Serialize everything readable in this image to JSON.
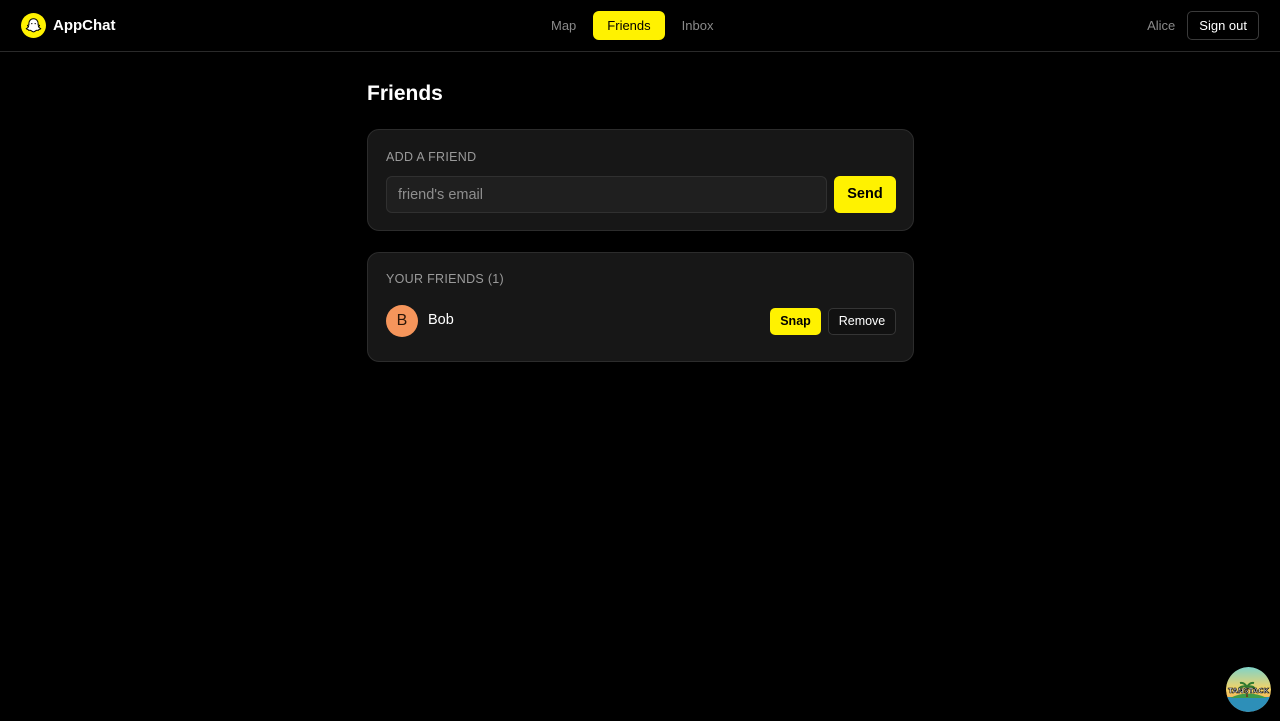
{
  "header": {
    "brand_name": "AppChat",
    "logo_icon": "ghost-icon",
    "nav": [
      {
        "label": "Map",
        "active": false
      },
      {
        "label": "Friends",
        "active": true
      },
      {
        "label": "Inbox",
        "active": false
      }
    ],
    "user_name": "Alice",
    "signout_label": "Sign out"
  },
  "page": {
    "title": "Friends"
  },
  "add_friend": {
    "label": "ADD A FRIEND",
    "placeholder": "friend's email",
    "value": "",
    "send_label": "Send"
  },
  "friends_list": {
    "label": "YOUR FRIENDS (1)",
    "items": [
      {
        "initial": "B",
        "name": "Bob",
        "avatar_color": "#f5955b",
        "snap_label": "Snap",
        "remove_label": "Remove"
      }
    ]
  },
  "devtools_badge": {
    "text": "TANSTACK",
    "icon": "tanstack-devtools-icon"
  },
  "colors": {
    "accent": "#fff200",
    "background": "#000000",
    "card": "#171717",
    "muted_text": "#8a8a8a"
  }
}
